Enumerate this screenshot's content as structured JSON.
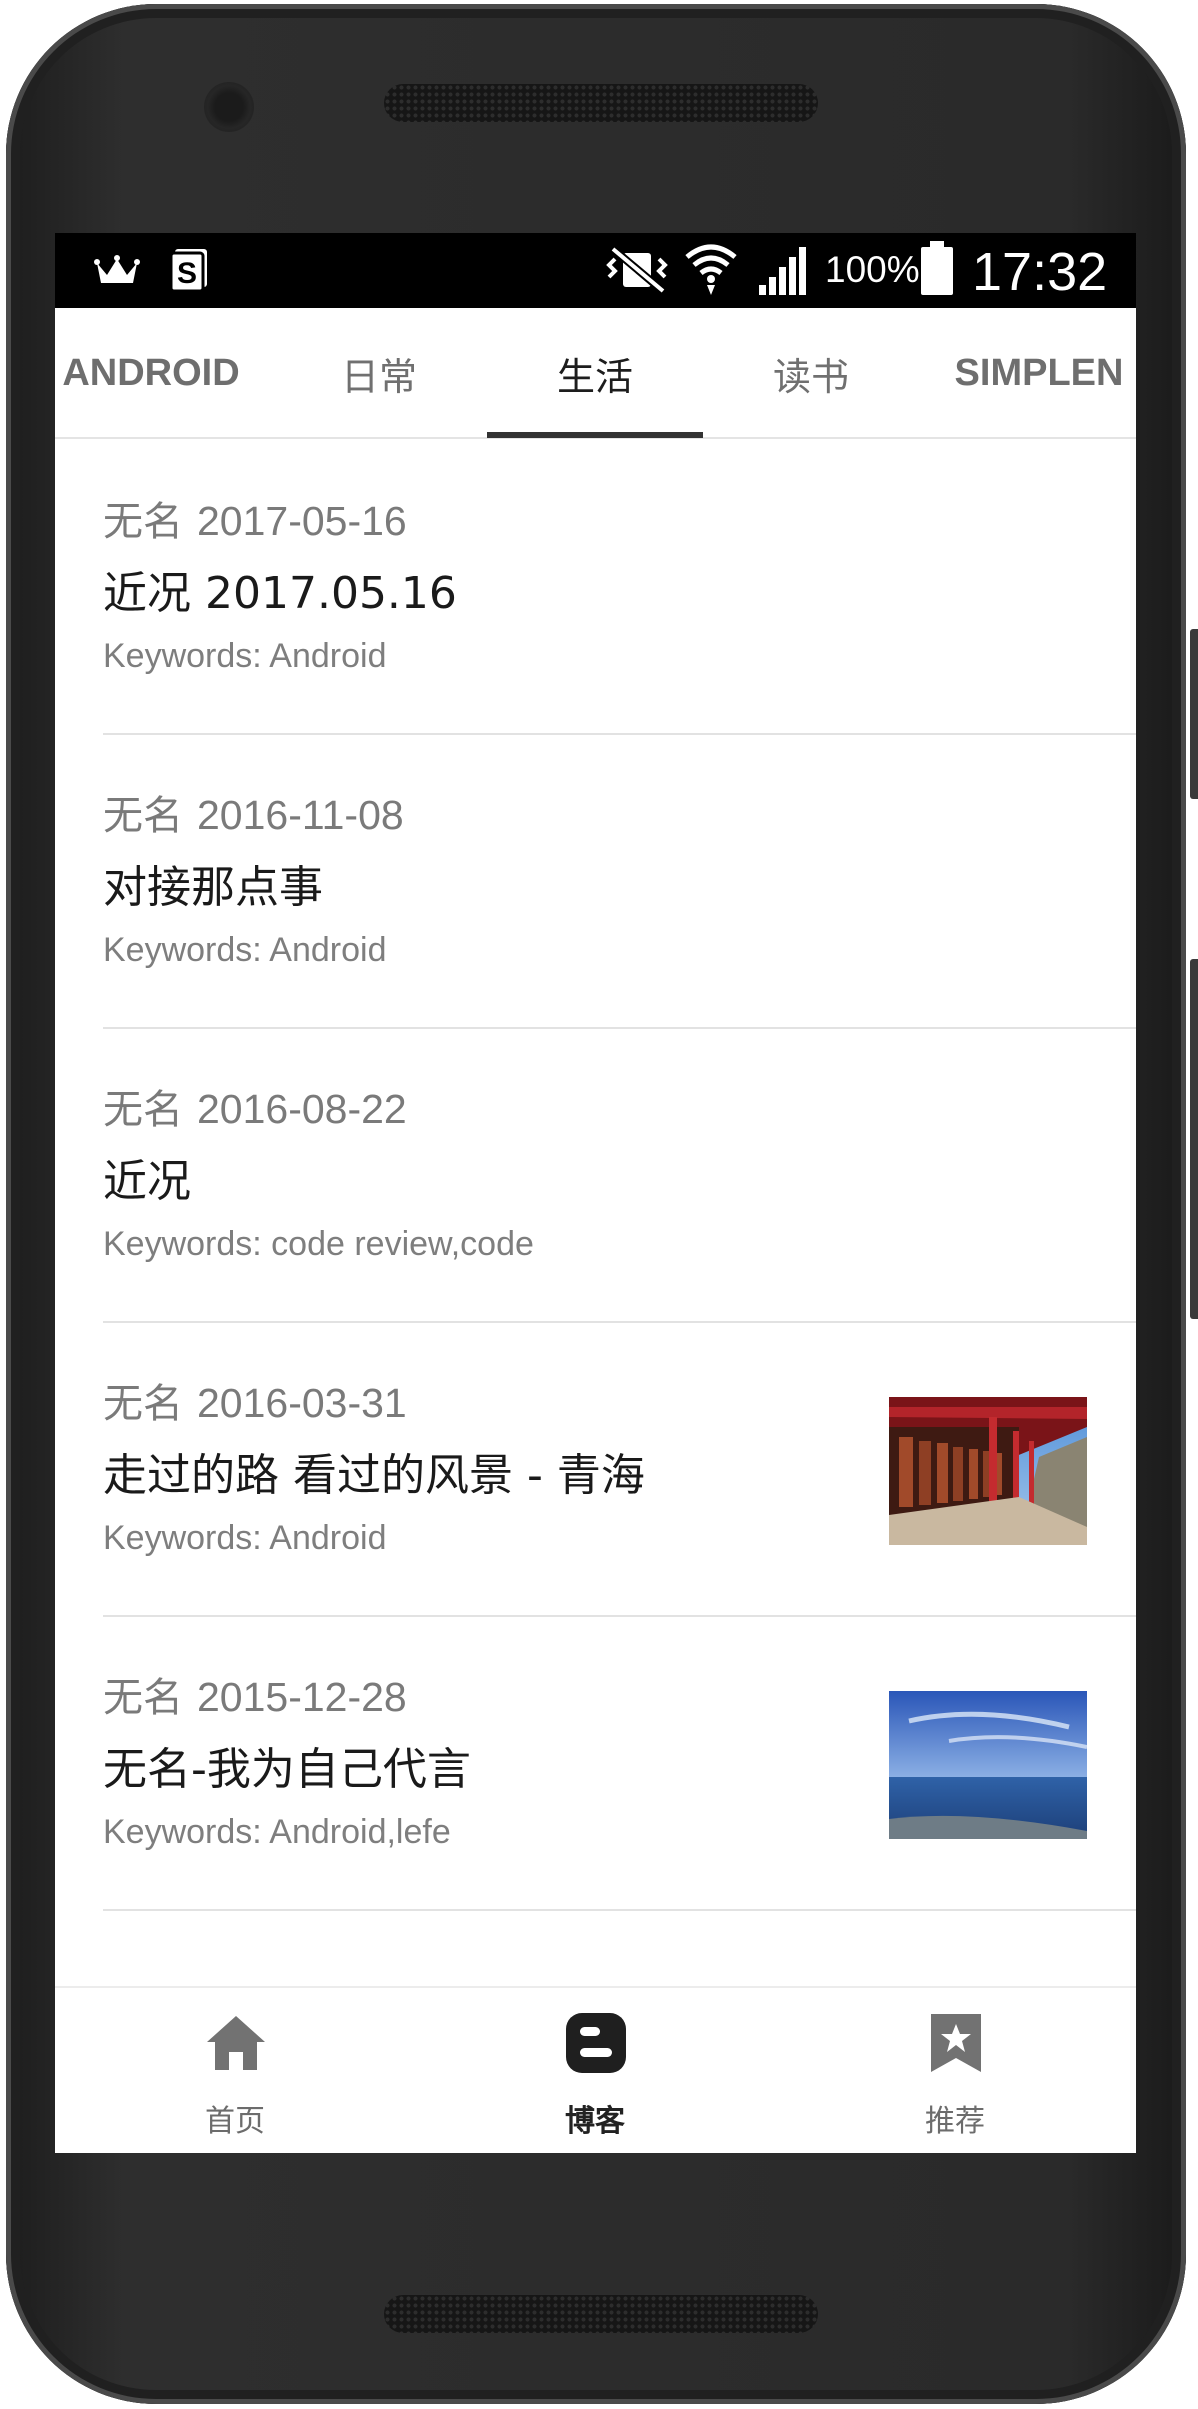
{
  "status_bar": {
    "battery": "100%",
    "time": "17:32",
    "icons": [
      "crown-icon",
      "s-badge-icon",
      "vibrate-mute-icon",
      "wifi-icon",
      "signal-icon",
      "battery-icon"
    ]
  },
  "tabs": [
    {
      "label": "ANDROID",
      "active": false
    },
    {
      "label": "日常",
      "active": false
    },
    {
      "label": "生活",
      "active": true
    },
    {
      "label": "读书",
      "active": false
    },
    {
      "label": "SIMPLEN",
      "active": false
    }
  ],
  "posts": [
    {
      "author": "无名",
      "date": "2017-05-16",
      "title": "近况 2017.05.16",
      "keywords": "Keywords: Android",
      "thumbnail": null
    },
    {
      "author": "无名",
      "date": "2016-11-08",
      "title": "对接那点事",
      "keywords": "Keywords: Android",
      "thumbnail": null
    },
    {
      "author": "无名",
      "date": "2016-08-22",
      "title": "近况",
      "keywords": "Keywords: code review,code",
      "thumbnail": null
    },
    {
      "author": "无名",
      "date": "2016-03-31",
      "title": "走过的路 看过的风景 - 青海",
      "keywords": "Keywords: Android",
      "thumbnail": "red-corridor-photo"
    },
    {
      "author": "无名",
      "date": "2015-12-28",
      "title": "无名-我为自己代言",
      "keywords": "Keywords: Android,lefe",
      "thumbnail": "blue-sea-photo"
    }
  ],
  "bottom_nav": [
    {
      "label": "首页",
      "icon": "home-icon",
      "active": false
    },
    {
      "label": "博客",
      "icon": "blogger-icon",
      "active": true
    },
    {
      "label": "推荐",
      "icon": "bookmark-star-icon",
      "active": false
    }
  ],
  "colors": {
    "accent": "#333333",
    "text_primary": "#1a1a1a",
    "text_secondary": "#7a7a7a",
    "bezel": "#2a2a2a"
  }
}
